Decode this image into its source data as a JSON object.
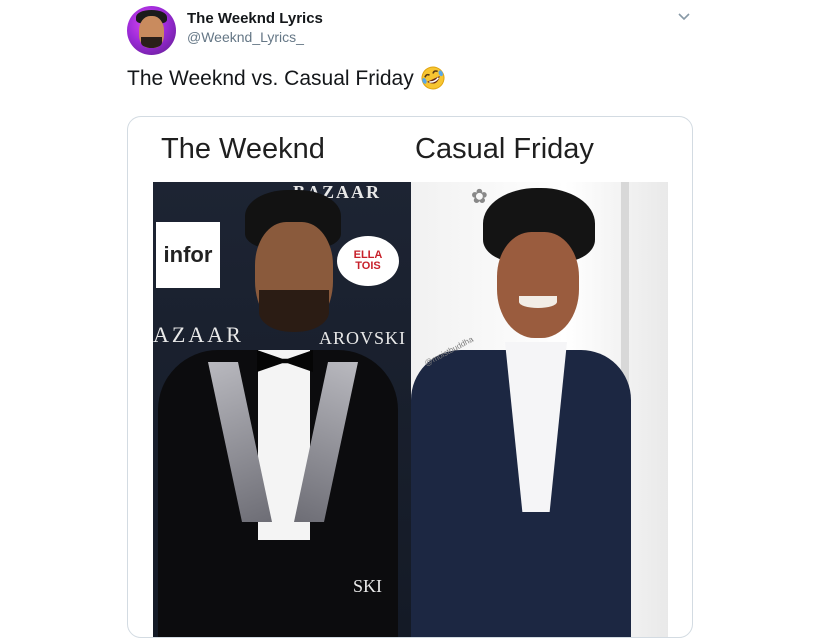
{
  "account": {
    "display_name": "The Weeknd Lyrics",
    "handle": "@Weeknd_Lyrics_"
  },
  "tweet": {
    "text": "The Weeknd vs. Casual Friday",
    "emoji": "rolling-on-the-floor-laughing-emoji"
  },
  "meme": {
    "caption_left": "The Weeknd",
    "caption_right": "Casual Friday",
    "left_photo_signs": {
      "top": "BAZAAR",
      "infor": "infor",
      "stella": "ELLA\nTOIS",
      "bazaar": "AZAAR",
      "swarovski": "AROVSKI",
      "bottom": "SKI"
    },
    "right_photo_watermark": "@moistbuddha"
  },
  "icons": {
    "caret": "chevron-down-icon"
  },
  "colors": {
    "text": "#14171a",
    "secondary": "#657786",
    "border": "#d3dbe2"
  }
}
